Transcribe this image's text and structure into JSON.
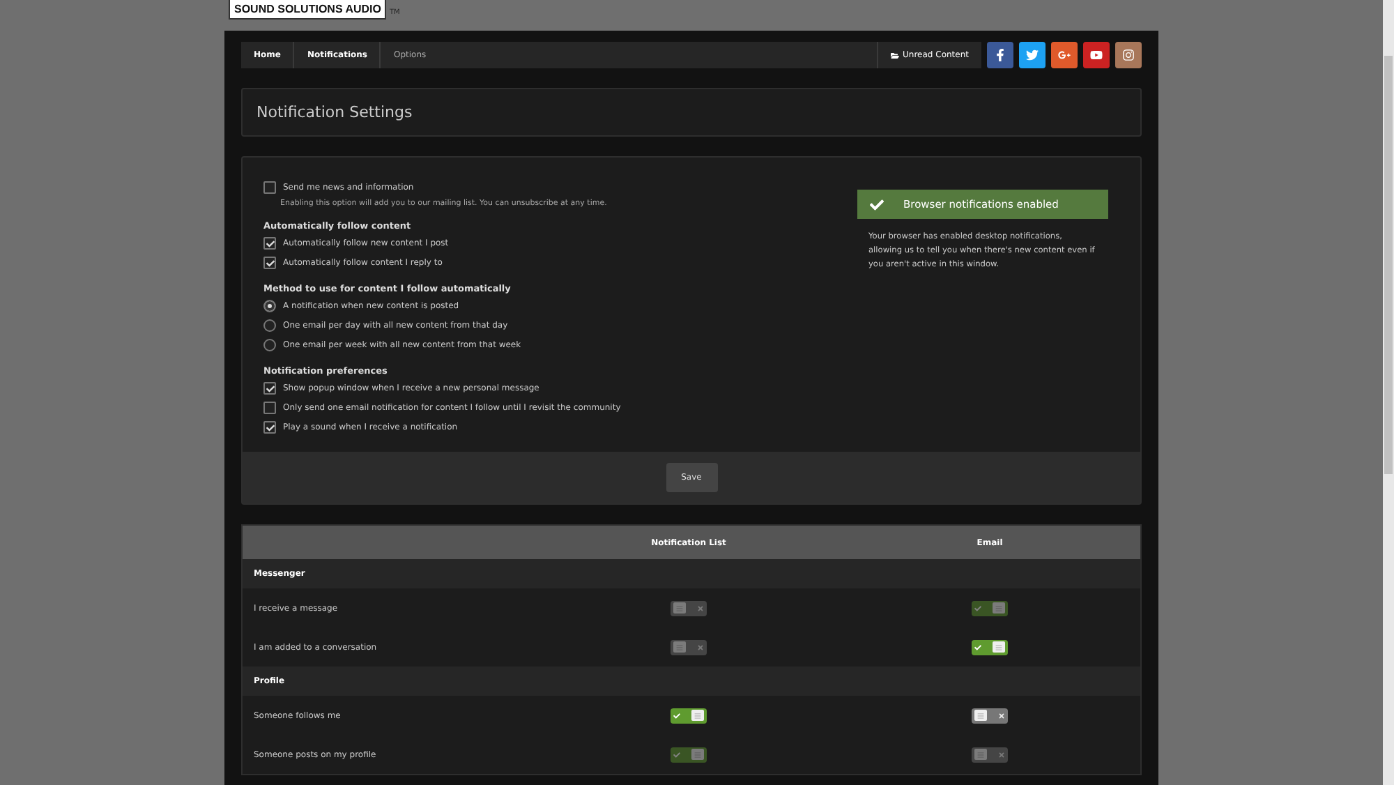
{
  "logo": {
    "text": "SOUND SOLUTIONS AUDIO",
    "mark": "TM"
  },
  "breadcrumb": [
    {
      "label": "Home",
      "selected": false
    },
    {
      "label": "Notifications",
      "selected": false
    },
    {
      "label": "Options",
      "selected": true
    }
  ],
  "unread": {
    "label": "Unread Content"
  },
  "social": [
    {
      "kind": "facebook",
      "color": "#3b5998"
    },
    {
      "kind": "twitter",
      "color": "#1da1f2"
    },
    {
      "kind": "google",
      "color": "#e05a2b"
    },
    {
      "kind": "youtube",
      "color": "#cc2222"
    },
    {
      "kind": "instagram",
      "color": "#a8775a"
    }
  ],
  "page_title": "Notification Settings",
  "news": {
    "label": "Send me news and information",
    "checked": false,
    "hint": "Enabling this option will add you to our mailing list. You can unsubscribe at any time."
  },
  "groups": [
    {
      "title": "Automatically follow content",
      "options": [
        {
          "kind": "checkbox",
          "label": "Automatically follow new content I post",
          "checked": true
        },
        {
          "kind": "checkbox",
          "label": "Automatically follow content I reply to",
          "checked": true
        }
      ]
    },
    {
      "title": "Method to use for content I follow automatically",
      "options": [
        {
          "kind": "radio",
          "label": "A notification when new content is posted",
          "checked": true
        },
        {
          "kind": "radio",
          "label": "One email per day with all new content from that day",
          "checked": false
        },
        {
          "kind": "radio",
          "label": "One email per week with all new content from that week",
          "checked": false
        }
      ]
    },
    {
      "title": "Notification preferences",
      "options": [
        {
          "kind": "checkbox",
          "label": "Show popup window when I receive a new personal message",
          "checked": true
        },
        {
          "kind": "checkbox",
          "label": "Only send one email notification for content I follow until I revisit the community",
          "checked": false
        },
        {
          "kind": "checkbox",
          "label": "Play a sound when I receive a notification",
          "checked": true
        }
      ]
    }
  ],
  "browser_notice": {
    "title": "Browser notifications enabled",
    "text": "Your browser has enabled desktop notifications, allowing us to tell you when there's new content even if you aren't active in this window."
  },
  "save_button": "Save",
  "table": {
    "columns": [
      "Notification List",
      "Email"
    ],
    "sections": [
      {
        "title": "Messenger",
        "rows": [
          {
            "label": "I receive a message",
            "toggles": [
              {
                "on": false,
                "disabled": true
              },
              {
                "on": true,
                "disabled": true
              }
            ]
          },
          {
            "label": "I am added to a conversation",
            "toggles": [
              {
                "on": false,
                "disabled": true
              },
              {
                "on": true,
                "disabled": false
              }
            ]
          }
        ]
      },
      {
        "title": "Profile",
        "rows": [
          {
            "label": "Someone follows me",
            "toggles": [
              {
                "on": true,
                "disabled": false
              },
              {
                "on": false,
                "disabled": false
              }
            ]
          },
          {
            "label": "Someone posts on my profile",
            "toggles": [
              {
                "on": true,
                "disabled": true
              },
              {
                "on": false,
                "disabled": true
              }
            ]
          }
        ]
      }
    ]
  }
}
